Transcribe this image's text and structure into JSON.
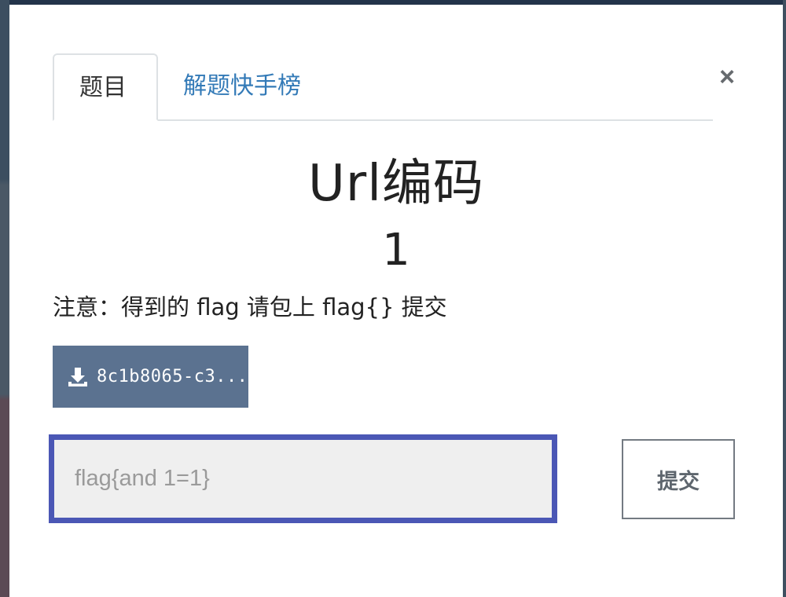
{
  "modal": {
    "close_label": "×",
    "tabs": [
      {
        "label": "题目",
        "active": true
      },
      {
        "label": "解题快手榜",
        "active": false
      }
    ],
    "challenge": {
      "name": "Url编码",
      "value": "1",
      "description": "注意：得到的 flag 请包上 flag{} 提交"
    },
    "file": {
      "label": "8c1b8065-c3...",
      "icon": "download-icon"
    },
    "flag_input": {
      "value": "",
      "placeholder": "flag{and 1=1}"
    },
    "submit_label": "提交"
  },
  "colors": {
    "tab_link": "#337ab7",
    "file_button_bg": "#5b7290",
    "input_focus_border": "#4b57b5",
    "input_bg": "#efefef"
  }
}
